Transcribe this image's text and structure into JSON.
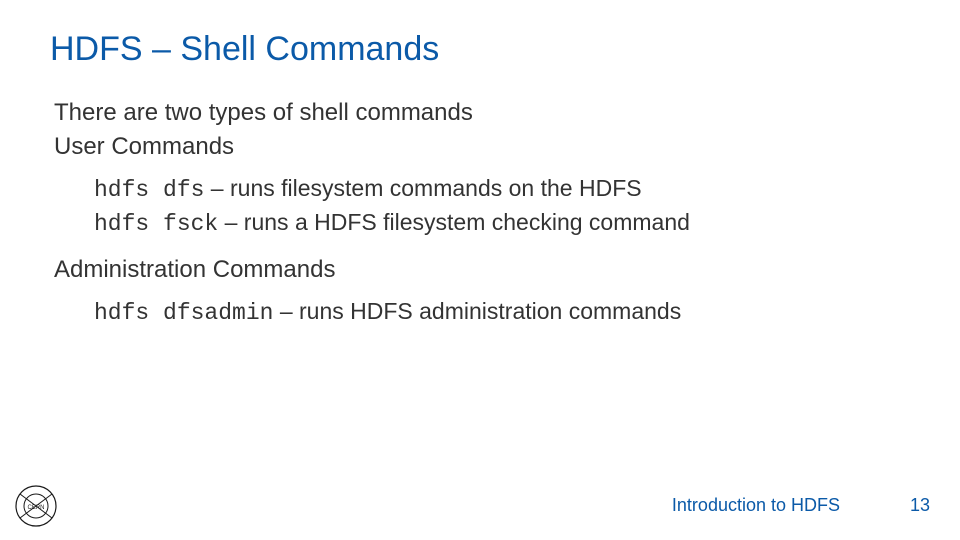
{
  "title": "HDFS – Shell Commands",
  "intro": "There are two types of shell commands",
  "sections": [
    {
      "label": "User Commands",
      "commands": [
        {
          "code": "hdfs dfs",
          "desc": " – runs filesystem commands on the HDFS"
        },
        {
          "code": "hdfs fsck",
          "desc": " – runs a HDFS filesystem checking command"
        }
      ]
    },
    {
      "label": "Administration Commands",
      "commands": [
        {
          "code": "hdfs dfsadmin",
          "desc": " – runs HDFS administration commands"
        }
      ]
    }
  ],
  "footer": {
    "doc_title": "Introduction to HDFS",
    "page": "13"
  }
}
